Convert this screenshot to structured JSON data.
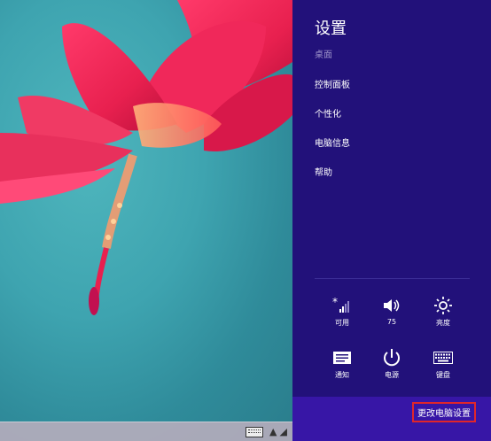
{
  "panel": {
    "title": "设置",
    "context": "桌面",
    "items": [
      {
        "label": "控制面板"
      },
      {
        "label": "个性化"
      },
      {
        "label": "电脑信息"
      },
      {
        "label": "帮助"
      }
    ],
    "tiles": [
      {
        "label": "可用",
        "icon": "network-icon"
      },
      {
        "label": "75",
        "icon": "volume-icon"
      },
      {
        "label": "亮度",
        "icon": "brightness-icon"
      },
      {
        "label": "通知",
        "icon": "notifications-icon"
      },
      {
        "label": "电源",
        "icon": "power-icon"
      },
      {
        "label": "键盘",
        "icon": "keyboard-icon"
      }
    ],
    "change_pc_settings": "更改电脑设置",
    "colors": {
      "panel_bg": "#22117a",
      "bottom_bar": "#3716a6",
      "highlight_border": "#e0262a"
    }
  }
}
